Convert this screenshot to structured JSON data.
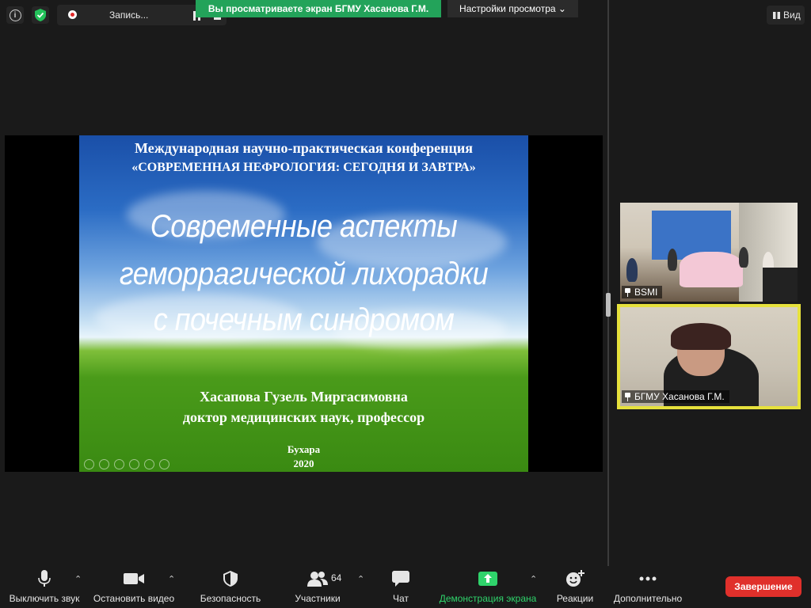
{
  "top": {
    "recording_label": "Запись...",
    "banner_text": "Вы просматриваете экран БГМУ  Хасанова Г.М.",
    "view_options": "Настройки просмотра ⌄",
    "view_button": "Вид"
  },
  "slide": {
    "conference_line1": "Международная научно-практическая конференция",
    "conference_line2": "«СОВРЕМЕННАЯ НЕФРОЛОГИЯ: СЕГОДНЯ И ЗАВТРА»",
    "title_line1": "Современные аспекты",
    "title_line2": "геморрагической лихорадки",
    "title_line3": "с почечным синдромом",
    "author": "Хасапова Гузель  Миргасимовна",
    "degree": "доктор медицинских наук, профессор",
    "city": "Бухара",
    "year": "2020"
  },
  "participants": [
    {
      "name": "BSMI"
    },
    {
      "name": "БГМУ  Хасанова Г.М."
    }
  ],
  "toolbar": {
    "mute": "Выключить звук",
    "stop_video": "Остановить видео",
    "security": "Безопасность",
    "participants": "Участники",
    "participants_count": "64",
    "chat": "Чат",
    "share_screen": "Демонстрация экрана",
    "reactions": "Реакции",
    "more": "Дополнительно",
    "end": "Завершение"
  },
  "colors": {
    "banner": "#23a35a",
    "end_button": "#e0302b",
    "active_speaker_border": "#e6e13c",
    "share_green": "#2fd36b"
  }
}
